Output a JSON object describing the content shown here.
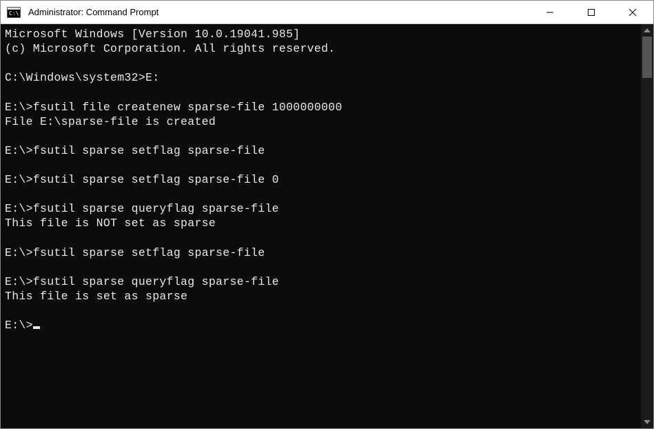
{
  "window": {
    "title": "Administrator: Command Prompt"
  },
  "terminal": {
    "lines": [
      {
        "text": "Microsoft Windows [Version 10.0.19041.985]"
      },
      {
        "text": "(c) Microsoft Corporation. All rights reserved."
      },
      {
        "text": ""
      },
      {
        "text": "C:\\Windows\\system32>E:"
      },
      {
        "text": ""
      },
      {
        "text": "E:\\>fsutil file createnew sparse-file 1000000000"
      },
      {
        "text": "File E:\\sparse-file is created"
      },
      {
        "text": ""
      },
      {
        "text": "E:\\>fsutil sparse setflag sparse-file"
      },
      {
        "text": ""
      },
      {
        "text": "E:\\>fsutil sparse setflag sparse-file 0"
      },
      {
        "text": ""
      },
      {
        "text": "E:\\>fsutil sparse queryflag sparse-file"
      },
      {
        "text": "This file is NOT set as sparse"
      },
      {
        "text": ""
      },
      {
        "text": "E:\\>fsutil sparse setflag sparse-file"
      },
      {
        "text": ""
      },
      {
        "text": "E:\\>fsutil sparse queryflag sparse-file"
      },
      {
        "text": "This file is set as sparse"
      },
      {
        "text": ""
      },
      {
        "text": "E:\\>",
        "hasCursor": true
      }
    ]
  }
}
